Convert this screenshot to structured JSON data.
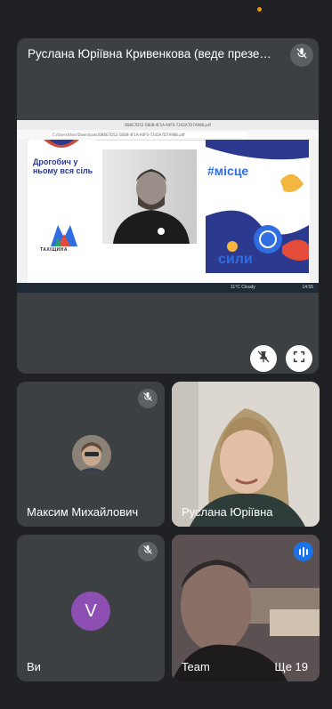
{
  "presentation": {
    "title": "Руслана Юріївна Кривенкова (веде презентац...",
    "screen": {
      "tab_text": "D86E7D52-5B08-4F1A-A0F0-7242A7D7A986.pdf",
      "address": "C:/Users/User/Downloads/D86E7D52-5B08-4F1A-A0F0-7242A7D7A986.pdf",
      "slide_left_text": "Дрогобич у ньому вся сіль",
      "slide_left_logo": "ТАХІЩИНА",
      "slide_right_title": "#місце",
      "slide_right_title2": "сили",
      "taskbar_weather": "11°C Cloudy",
      "taskbar_time": "14:55"
    }
  },
  "participants": [
    {
      "name": "Максим Михайлович",
      "muted": true
    },
    {
      "name": "Руслана Юріївна",
      "muted": false
    },
    {
      "name": "Ви",
      "avatar_letter": "V",
      "avatar_color": "#8e4fb3",
      "muted": true
    },
    {
      "name": "Team",
      "speaking": true,
      "more": "Ще 19"
    }
  ],
  "colors": {
    "background": "#202124",
    "tile": "#3c4043",
    "speaking": "#1a73e8",
    "accent_dot": "#f29900"
  },
  "icons": {
    "mic_off": "mic-off-icon",
    "pin_off": "pin-off-icon",
    "fullscreen": "fullscreen-icon",
    "speaking": "audio-level-icon"
  }
}
